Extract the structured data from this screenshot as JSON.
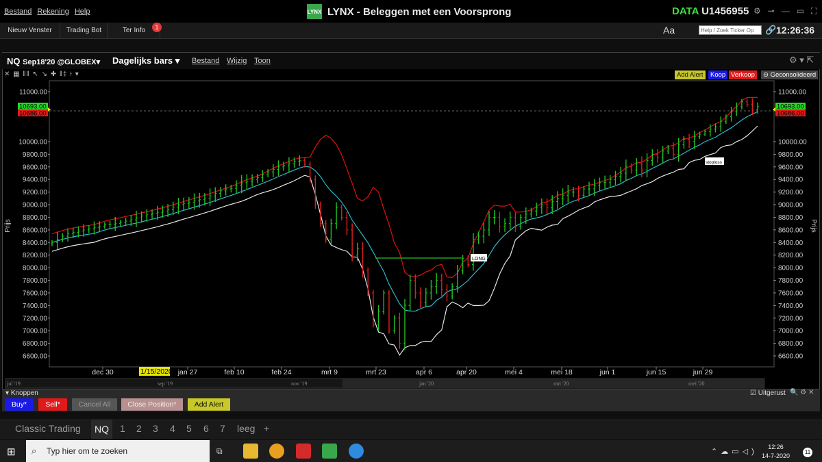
{
  "menu": [
    "Bestand",
    "Rekening",
    "Help"
  ],
  "app_title": "Beleggen met een Voorsprong",
  "logo_text": "LYNX",
  "account_mode": "DATA",
  "account_id": "U1456955",
  "toolbar": {
    "nieuw_venster": "Nieuw Venster",
    "trading_bot": "Trading Bot",
    "ter_info": "Ter Info",
    "ter_info_badge": "1"
  },
  "font_button": "Aa",
  "search_placeholder": "Help / Zoek Ticker Op",
  "time": "12:26:36",
  "chart_header": {
    "symbol": "NQ",
    "contract": "Sep18'20 @GLOBEX",
    "bar_type": "Dagelijks bars",
    "menus": [
      "Bestand",
      "Wijzig",
      "Toon"
    ]
  },
  "order_buttons": {
    "add_alert": "Add Alert",
    "koop": "Koop",
    "verkoop": "Verkoop",
    "geconsolideerd": "Geconsolideerd"
  },
  "y_axis_label": "Prijs",
  "price_tags": {
    "last": "10693.00",
    "bid": "10686.00"
  },
  "x_date_highlight": "1/15/2020",
  "annotations": {
    "long": "LONG",
    "stoploss": "stoploss"
  },
  "overview_labels": [
    "jul '19",
    "sep '19",
    "nov '19",
    "jan '20",
    "mrt '20",
    "mei '20"
  ],
  "knoppen": {
    "title": "Knoppen",
    "uitgerust": "Uitgerust",
    "buy": "Buy*",
    "sell": "Sell*",
    "cancel_all": "Cancel All",
    "close_position": "Close Position*",
    "add_alert": "Add Alert"
  },
  "tabs": [
    "Classic Trading",
    "NQ",
    "1",
    "2",
    "3",
    "4",
    "5",
    "6",
    "7",
    "leeg",
    "+"
  ],
  "taskbar": {
    "search_placeholder": "Typ hier om te zoeken",
    "time": "12:26",
    "date": "14-7-2020",
    "notifications": "11"
  },
  "colors": {
    "up_bar": "#22c322",
    "down_bar": "#e02020",
    "upper_band": "#e01010",
    "middle_band": "#2ab8c8",
    "lower_band": "#e8e8e8",
    "long_line": "#22c322"
  },
  "chart_data": {
    "type": "line",
    "ylabel": "Prijs",
    "ylim": [
      6500,
      11150
    ],
    "y_ticks": [
      11000,
      10000,
      9800,
      9600,
      9400,
      9200,
      9000,
      8800,
      8600,
      8400,
      8200,
      8000,
      7800,
      7600,
      7400,
      7200,
      7000,
      6800,
      6600
    ],
    "x_tick_labels": [
      "dec 30",
      "jan 27",
      "feb 10",
      "feb 24",
      "mrt 9",
      "mrt 23",
      "apr 6",
      "apr 20",
      "mei 4",
      "mei 18",
      "jun 1",
      "jun 15",
      "jun 29"
    ],
    "series": [],
    "closes": [
      8400,
      8450,
      8500,
      8540,
      8560,
      8580,
      8600,
      8620,
      8640,
      8660,
      8680,
      8690,
      8700,
      8720,
      8740,
      8760,
      8790,
      8820,
      8840,
      8860,
      8880,
      8900,
      8920,
      8960,
      9000,
      9020,
      9040,
      9060,
      9080,
      9100,
      9140,
      9180,
      9220,
      9250,
      9260,
      9300,
      9350,
      9370,
      9400,
      9430,
      9480,
      9520,
      9560,
      9600,
      9620,
      9650,
      9690,
      9700,
      9640,
      9400,
      9000,
      8700,
      8450,
      8700,
      8950,
      8800,
      8600,
      8200,
      8300,
      7950,
      7600,
      7100,
      7300,
      7600,
      7000,
      7200,
      6800,
      7400,
      7800,
      7600,
      7450,
      7600,
      7700,
      7800,
      7650,
      7550,
      7700,
      7950,
      8150,
      8050,
      8450,
      8500,
      8600,
      8800,
      8800,
      8650,
      8700,
      8800,
      8650,
      8800,
      8850,
      8900,
      8950,
      9000,
      8950,
      9050,
      9100,
      9150,
      9200,
      9200,
      9150,
      9250,
      9250,
      9300,
      9350,
      9350,
      9400,
      9450,
      9500,
      9600,
      9550,
      9650,
      9550,
      9700,
      9800,
      9750,
      9850,
      9900,
      9800,
      9950,
      10050,
      10000,
      10100,
      10150,
      10200,
      10250,
      10300,
      10400,
      10500,
      10600,
      10700,
      10800,
      10750,
      10650,
      10700
    ],
    "annotations": [
      {
        "label": "LONG",
        "price": 8000
      },
      {
        "label": "stoploss",
        "price": 9600
      }
    ]
  }
}
